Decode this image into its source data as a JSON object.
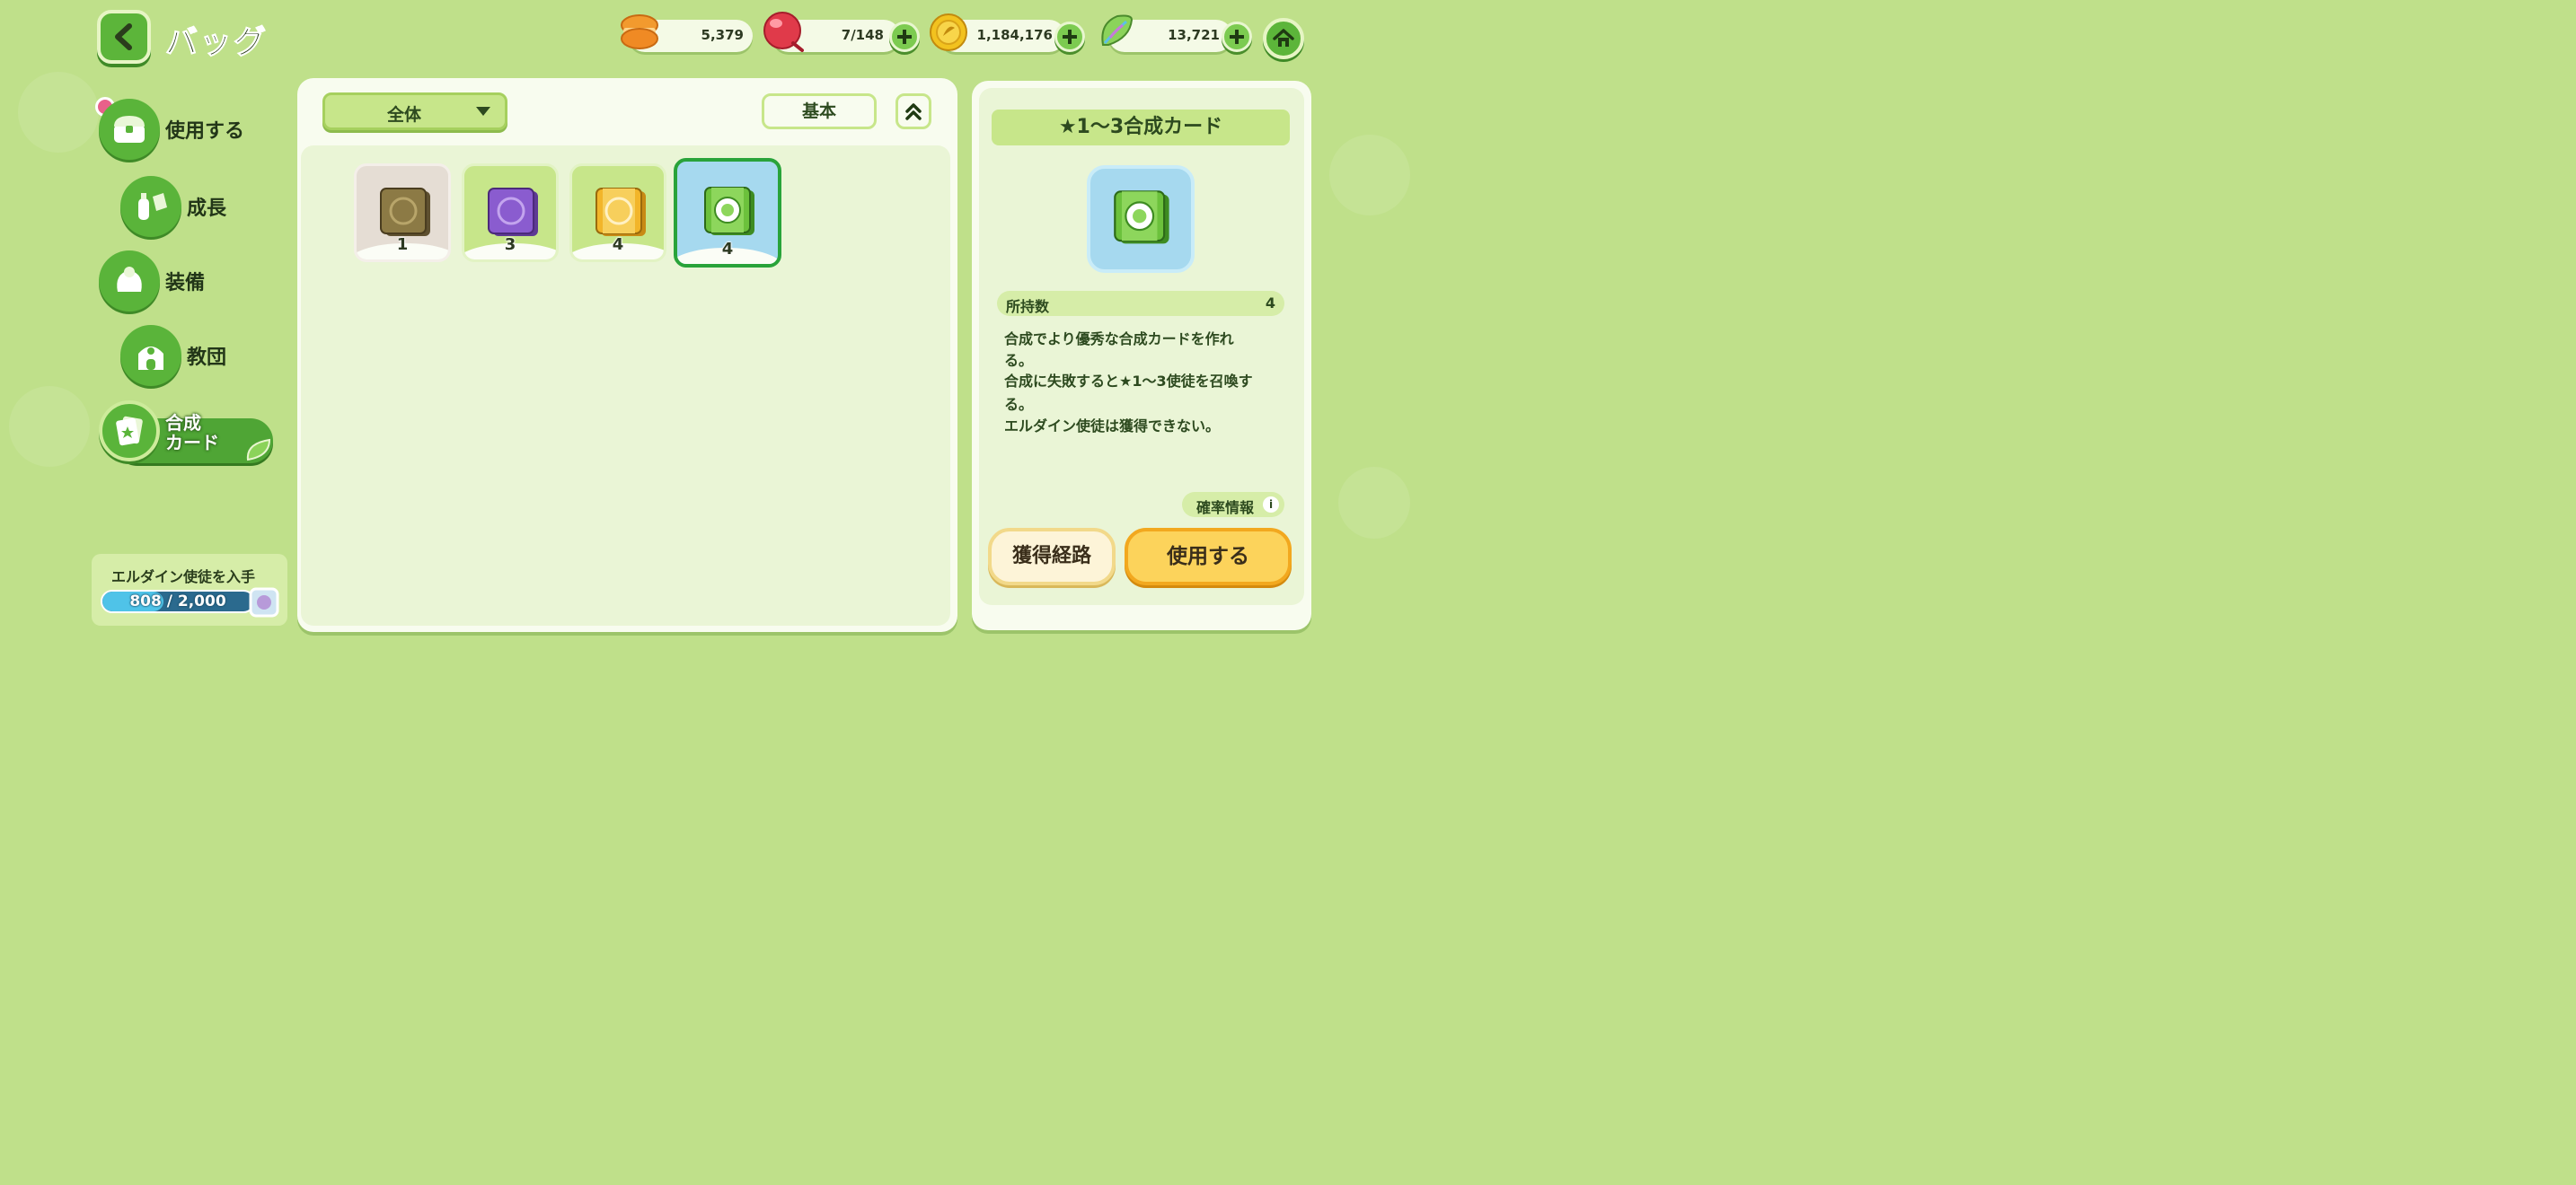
{
  "header": {
    "title": "バッグ",
    "resources": [
      {
        "name": "orange-macaron",
        "value": "5,379",
        "color": "#f08a24"
      },
      {
        "name": "red-candy",
        "value": "7/148",
        "color": "#e03a4a"
      },
      {
        "name": "gold-coin",
        "value": "1,184,176",
        "color": "#f2c21f"
      },
      {
        "name": "rainbow-leaf",
        "value": "13,721",
        "color": "#8bd35a"
      }
    ]
  },
  "sidebar": {
    "items": [
      {
        "label": "使用する",
        "icon": "chest-icon"
      },
      {
        "label": "成長",
        "icon": "potion-icon"
      },
      {
        "label": "装備",
        "icon": "costume-icon"
      },
      {
        "label": "教団",
        "icon": "temple-icon"
      },
      {
        "label": "合成\nカード",
        "icon": "card-icon",
        "active": true
      }
    ],
    "progress": {
      "title": "エルダイン使徒を入手",
      "text": "808 / 2,000",
      "current": 808,
      "max": 2000
    }
  },
  "main": {
    "filter_label": "全体",
    "sort_label": "基本",
    "items": [
      {
        "count": "1",
        "rarity": "bronze",
        "color": "#8c7a45"
      },
      {
        "count": "3",
        "rarity": "purple",
        "color": "#8a5ccf"
      },
      {
        "count": "4",
        "rarity": "gold",
        "color": "#f2b52a"
      },
      {
        "count": "4",
        "rarity": "green",
        "color": "#6cc13c",
        "selected": true
      }
    ]
  },
  "detail": {
    "title": "★1～3合成カード",
    "owned_label": "所持数",
    "owned_value": "4",
    "desc": [
      "合成でより優秀な合成カードを作れ",
      "る。",
      "合成に失敗すると★1～3使徒を召喚す",
      "る。",
      "エルダイン使徒は獲得できない。"
    ],
    "prob_label": "確率情報",
    "source_button": "獲得経路",
    "use_button": "使用する"
  }
}
